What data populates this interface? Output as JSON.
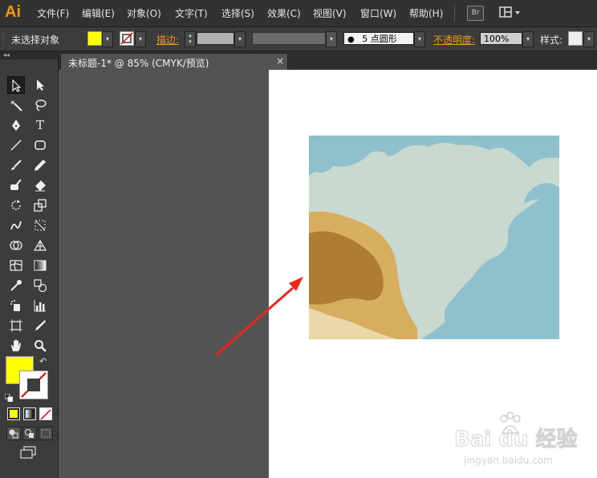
{
  "app": {
    "logo": "Ai",
    "menus": [
      "文件(F)",
      "编辑(E)",
      "对象(O)",
      "文字(T)",
      "选择(S)",
      "效果(C)",
      "视图(V)",
      "窗口(W)",
      "帮助(H)"
    ],
    "bridge_label": "Br"
  },
  "control_bar": {
    "selection_status": "未选择对象",
    "fill_color": "#ffff00",
    "stroke_label": "描边:",
    "brush_size": "5",
    "brush_name": "点圆形",
    "opacity_label": "不透明度:",
    "opacity_value": "100%",
    "style_label": "样式:"
  },
  "document": {
    "tab_title": "未标题-1* @ 85% (CMYK/预览)",
    "close_glyph": "×"
  },
  "toolbox": {
    "collapse_glyph": "◂◂",
    "fill_color": "#ffff00",
    "stroke_color": "none"
  },
  "colors": {
    "accent": "#ef9a1a",
    "annotation_arrow": "#e8271e",
    "map_water": "#8fc0cd",
    "map_land": "#c9d9d0",
    "map_tan": "#d7ad5e",
    "map_brown": "#ae7c34"
  },
  "watermark": {
    "brand": "Bai du 经验",
    "url": "jingyan.baidu.com"
  }
}
